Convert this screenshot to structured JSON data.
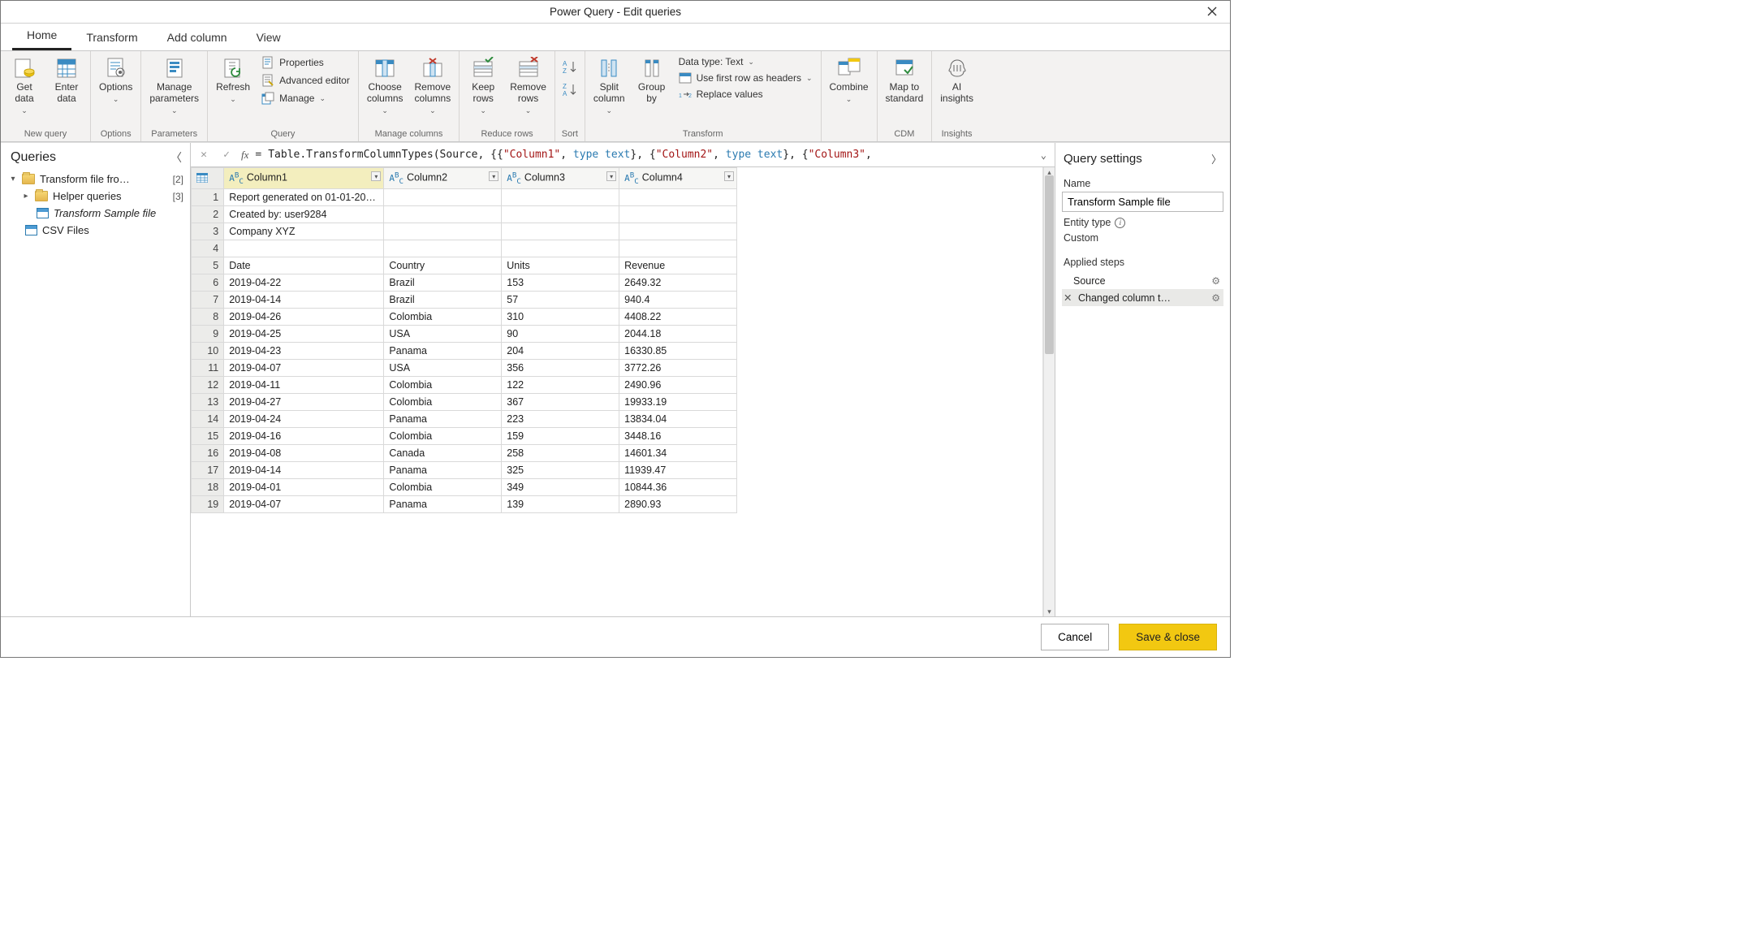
{
  "window": {
    "title": "Power Query - Edit queries"
  },
  "tabs": {
    "home": "Home",
    "transform": "Transform",
    "addcolumn": "Add column",
    "view": "View"
  },
  "ribbon": {
    "newquery": {
      "label": "New query",
      "getdata": "Get\ndata",
      "enterdata": "Enter\ndata"
    },
    "options_grp": {
      "label": "Options",
      "options": "Options"
    },
    "parameters": {
      "label": "Parameters",
      "manage": "Manage\nparameters"
    },
    "query": {
      "label": "Query",
      "refresh": "Refresh",
      "properties": "Properties",
      "advanced": "Advanced editor",
      "manage": "Manage"
    },
    "managecols": {
      "label": "Manage columns",
      "choose": "Choose\ncolumns",
      "remove": "Remove\ncolumns"
    },
    "reducerows": {
      "label": "Reduce rows",
      "keep": "Keep\nrows",
      "remove": "Remove\nrows"
    },
    "sort": {
      "label": "Sort"
    },
    "transform": {
      "label": "Transform",
      "split": "Split\ncolumn",
      "groupby": "Group\nby",
      "datatype": "Data type: Text",
      "firstrow": "Use first row as headers",
      "replace": "Replace values"
    },
    "combine_grp": {
      "combine": "Combine"
    },
    "cdm": {
      "label": "CDM",
      "map": "Map to\nstandard"
    },
    "insights": {
      "label": "Insights",
      "ai": "AI\ninsights"
    }
  },
  "queries": {
    "title": "Queries",
    "folder1": "Transform file fro…",
    "folder1_count": "[2]",
    "folder2": "Helper queries",
    "folder2_count": "[3]",
    "item_sample": "Transform Sample file",
    "item_csv": "CSV Files"
  },
  "formula": {
    "prefix": "Table.TransformColumnTypes(Source, {{",
    "s1": "\"Column1\"",
    "c1": ", ",
    "kw1": "type text",
    "mid1": "}, {",
    "s2": "\"Column2\"",
    "c2": ", ",
    "kw2": "type text",
    "mid2": "}, {",
    "s3": "\"Column3\"",
    "tail": ","
  },
  "columns": {
    "c1": "Column1",
    "c2": "Column2",
    "c3": "Column3",
    "c4": "Column4"
  },
  "rows": [
    {
      "n": "1",
      "c1": "Report generated on 01-01-20…",
      "c2": "",
      "c3": "",
      "c4": ""
    },
    {
      "n": "2",
      "c1": "Created by: user9284",
      "c2": "",
      "c3": "",
      "c4": ""
    },
    {
      "n": "3",
      "c1": "Company XYZ",
      "c2": "",
      "c3": "",
      "c4": ""
    },
    {
      "n": "4",
      "c1": "",
      "c2": "",
      "c3": "",
      "c4": ""
    },
    {
      "n": "5",
      "c1": "Date",
      "c2": "Country",
      "c3": "Units",
      "c4": "Revenue"
    },
    {
      "n": "6",
      "c1": "2019-04-22",
      "c2": "Brazil",
      "c3": "153",
      "c4": "2649.32"
    },
    {
      "n": "7",
      "c1": "2019-04-14",
      "c2": "Brazil",
      "c3": "57",
      "c4": "940.4"
    },
    {
      "n": "8",
      "c1": "2019-04-26",
      "c2": "Colombia",
      "c3": "310",
      "c4": "4408.22"
    },
    {
      "n": "9",
      "c1": "2019-04-25",
      "c2": "USA",
      "c3": "90",
      "c4": "2044.18"
    },
    {
      "n": "10",
      "c1": "2019-04-23",
      "c2": "Panama",
      "c3": "204",
      "c4": "16330.85"
    },
    {
      "n": "11",
      "c1": "2019-04-07",
      "c2": "USA",
      "c3": "356",
      "c4": "3772.26"
    },
    {
      "n": "12",
      "c1": "2019-04-11",
      "c2": "Colombia",
      "c3": "122",
      "c4": "2490.96"
    },
    {
      "n": "13",
      "c1": "2019-04-27",
      "c2": "Colombia",
      "c3": "367",
      "c4": "19933.19"
    },
    {
      "n": "14",
      "c1": "2019-04-24",
      "c2": "Panama",
      "c3": "223",
      "c4": "13834.04"
    },
    {
      "n": "15",
      "c1": "2019-04-16",
      "c2": "Colombia",
      "c3": "159",
      "c4": "3448.16"
    },
    {
      "n": "16",
      "c1": "2019-04-08",
      "c2": "Canada",
      "c3": "258",
      "c4": "14601.34"
    },
    {
      "n": "17",
      "c1": "2019-04-14",
      "c2": "Panama",
      "c3": "325",
      "c4": "11939.47"
    },
    {
      "n": "18",
      "c1": "2019-04-01",
      "c2": "Colombia",
      "c3": "349",
      "c4": "10844.36"
    },
    {
      "n": "19",
      "c1": "2019-04-07",
      "c2": "Panama",
      "c3": "139",
      "c4": "2890.93"
    }
  ],
  "settings": {
    "title": "Query settings",
    "name_label": "Name",
    "name_value": "Transform Sample file",
    "entity_label": "Entity type",
    "entity_value": "Custom",
    "steps_label": "Applied steps",
    "step1": "Source",
    "step2": "Changed column t…"
  },
  "footer": {
    "cancel": "Cancel",
    "save": "Save & close"
  }
}
